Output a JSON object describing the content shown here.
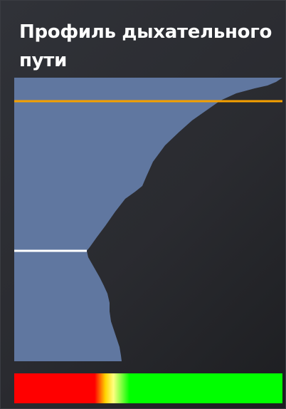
{
  "title": "Профиль дыхательного пути",
  "colors": {
    "panel_background": "#2e3035",
    "airway_fill": "#6077a0",
    "upper_marker": "#f5a000",
    "lower_marker": "#ffffff",
    "scale_stops": [
      "#ff0000",
      "#ff0000",
      "#ffd400",
      "#ffff80",
      "#00ff00",
      "#00ff00"
    ]
  },
  "scale_stop_positions": [
    0,
    0.3,
    0.34,
    0.37,
    0.43,
    1
  ]
}
